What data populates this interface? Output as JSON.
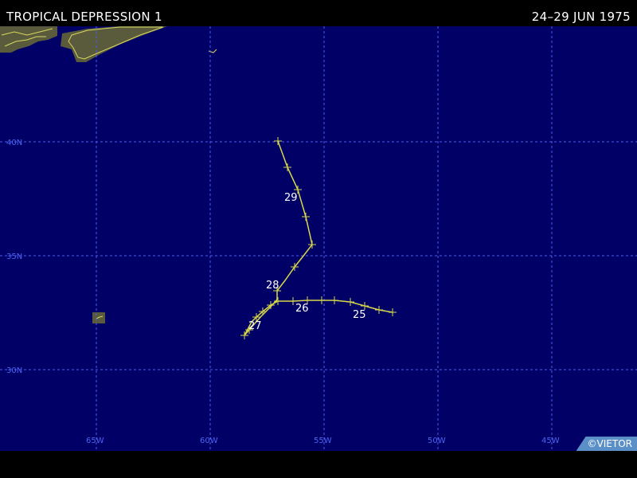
{
  "header": {
    "title": "TROPICAL DEPRESSION 1",
    "date_range": "24–29 JUN 1975"
  },
  "map": {
    "background_color": "#000066",
    "grid_color": "#4a5cf0",
    "land_color": "#5a5a3c",
    "coast_color": "#d8d860",
    "track_color": "#d8d84a",
    "lat_labels": [
      "40N",
      "35N",
      "30N"
    ],
    "lon_labels": [
      "65W",
      "60W",
      "55W",
      "50W",
      "45W"
    ],
    "day_labels": [
      "25",
      "26",
      "27",
      "28",
      "29"
    ]
  },
  "credit": "©VIETOR"
}
